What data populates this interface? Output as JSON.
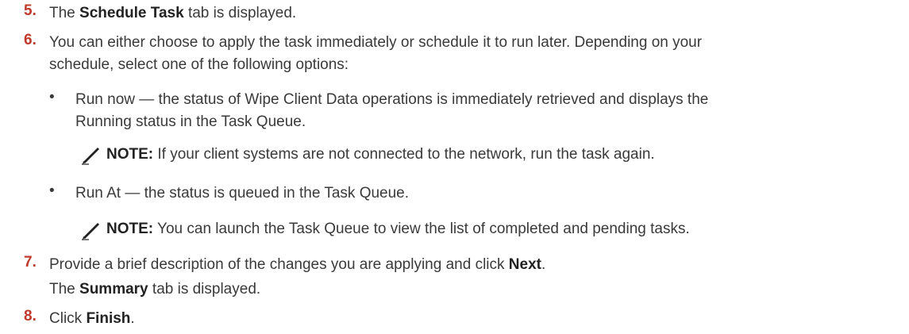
{
  "steps": {
    "s5": {
      "num": "5.",
      "pre": "The ",
      "bold": "Schedule Task",
      "post": " tab is displayed."
    },
    "s6": {
      "num": "6.",
      "line1": "You can either choose to apply the task immediately or schedule it to run later. Depending on your",
      "line2": "schedule, select one of the following options:"
    },
    "bullet1": {
      "line1": "Run now — the status of Wipe Client Data operations is immediately retrieved and displays the",
      "line2": "Running status in the Task Queue."
    },
    "note1": {
      "label": "NOTE:",
      "text": " If your client systems are not connected to the network, run the task again."
    },
    "bullet2": {
      "text": "Run At — the status is queued in the Task Queue."
    },
    "note2": {
      "label": "NOTE:",
      "text": " You can launch the Task Queue to view the list of completed and pending tasks."
    },
    "s7": {
      "num": "7.",
      "pre": "Provide a brief description of the changes you are applying and click ",
      "bold": "Next",
      "post": "."
    },
    "s7b": {
      "pre": "The ",
      "bold": "Summary",
      "post": " tab is displayed."
    },
    "s8": {
      "num": "8.",
      "pre": "Click ",
      "bold": "Finish",
      "post": "."
    }
  },
  "bullet_char": "•",
  "icons": {
    "note": "pencil-note-icon"
  },
  "colors": {
    "step_number": "#c0392b",
    "text": "#3a3a3a"
  }
}
